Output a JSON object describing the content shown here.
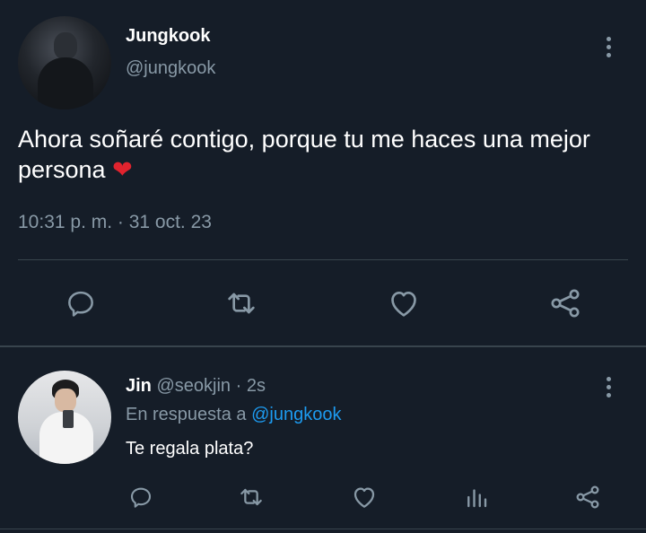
{
  "main_tweet": {
    "display_name": "Jungkook",
    "handle": "@jungkook",
    "text": "Ahora soñaré contigo, porque tu me haces una mejor persona",
    "emoji": "❤",
    "timestamp": "10:31 p. m. · 31 oct. 23",
    "actions": [
      "reply-icon",
      "retweet-icon",
      "like-icon",
      "share-icon"
    ]
  },
  "reply": {
    "display_name": "Jin",
    "handle": "@seokjin",
    "time_sep": "·",
    "time": "2s",
    "reply_prefix": "En respuesta a",
    "reply_mention": "@jungkook",
    "text": "Te regala plata?",
    "actions": [
      "reply-icon",
      "retweet-icon",
      "like-icon",
      "analytics-icon",
      "share-icon"
    ]
  },
  "colors": {
    "background": "#151d28",
    "secondary_text": "#8899a6",
    "mention": "#1d9bf0",
    "divider": "#38444d"
  }
}
